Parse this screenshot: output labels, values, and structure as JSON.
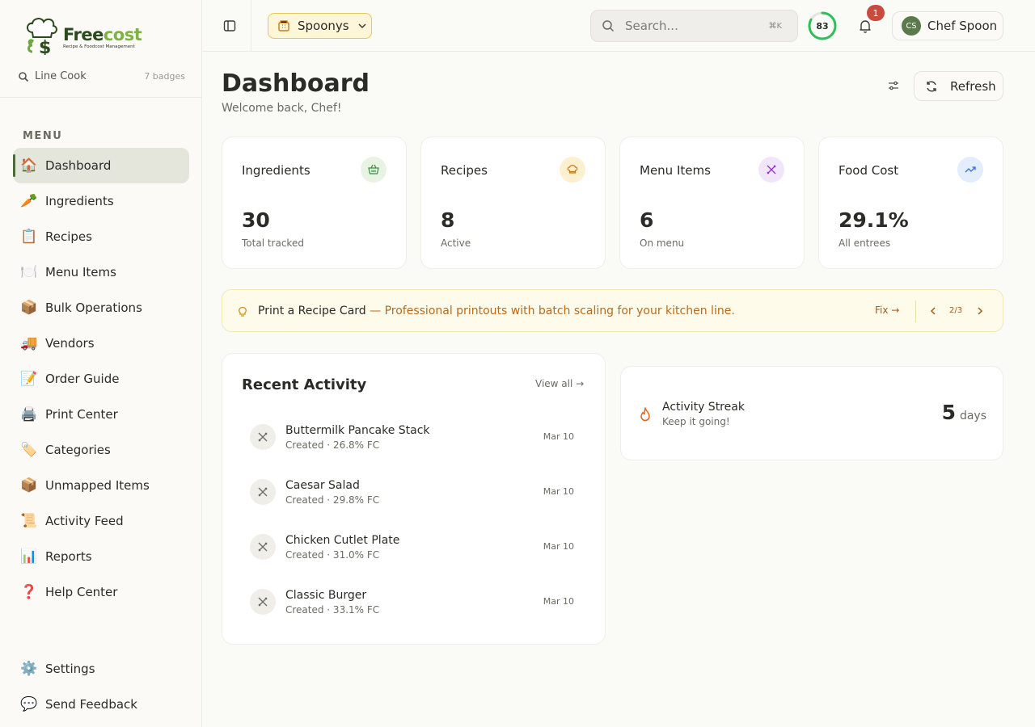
{
  "brand": {
    "name_part1": "Free",
    "name_part2": "cost",
    "tagline": "Recipe & Foodcost Management"
  },
  "sidebar": {
    "role": "Line Cook",
    "badges": "7 badges",
    "menu_label": "MENU",
    "items": [
      {
        "icon": "🏠",
        "label": "Dashboard",
        "active": true
      },
      {
        "icon": "🥕",
        "label": "Ingredients"
      },
      {
        "icon": "📋",
        "label": "Recipes"
      },
      {
        "icon": "🍽️",
        "label": "Menu Items"
      },
      {
        "icon": "📦",
        "label": "Bulk Operations"
      },
      {
        "icon": "🚚",
        "label": "Vendors"
      },
      {
        "icon": "📝",
        "label": "Order Guide"
      },
      {
        "icon": "🖨️",
        "label": "Print Center"
      },
      {
        "icon": "🏷️",
        "label": "Categories"
      },
      {
        "icon": "📦",
        "label": "Unmapped Items"
      },
      {
        "icon": "📜",
        "label": "Activity Feed"
      },
      {
        "icon": "📊",
        "label": "Reports"
      },
      {
        "icon": "❓",
        "label": "Help Center"
      }
    ],
    "bottom_items": [
      {
        "icon": "⚙️",
        "label": "Settings"
      },
      {
        "icon": "💬",
        "label": "Send Feedback"
      }
    ]
  },
  "topbar": {
    "store": "Spoonys",
    "search_placeholder": "Search...",
    "search_shortcut": "⌘K",
    "score": "83",
    "score_fraction": 0.83,
    "notifications": "1",
    "user_initials": "CS",
    "user_name": "Chef Spoon"
  },
  "page": {
    "title": "Dashboard",
    "subtitle": "Welcome back, Chef!",
    "refresh_label": "Refresh"
  },
  "stats": [
    {
      "title": "Ingredients",
      "value": "30",
      "sub": "Total tracked",
      "icon": "basket-icon",
      "icon_bg": "#e8f3e4",
      "icon_color": "#3d8b3d"
    },
    {
      "title": "Recipes",
      "value": "8",
      "sub": "Active",
      "icon": "chef-hat-icon",
      "icon_bg": "#fdf0cf",
      "icon_color": "#c97a12"
    },
    {
      "title": "Menu Items",
      "value": "6",
      "sub": "On menu",
      "icon": "utensils-icon",
      "icon_bg": "#f1e6f9",
      "icon_color": "#9333c9"
    },
    {
      "title": "Food Cost",
      "value": "29.1%",
      "sub": "All entrees",
      "icon": "trending-up-icon",
      "icon_bg": "#e3edfb",
      "icon_color": "#2f6fd6"
    }
  ],
  "tip": {
    "title": "Print a Recipe Card",
    "text": " — Professional printouts with batch scaling for your kitchen line.",
    "fix_label": "Fix →",
    "page": "2/3"
  },
  "activity": {
    "title": "Recent Activity",
    "view_all": "View all →",
    "items": [
      {
        "name": "Buttermilk Pancake Stack",
        "meta": "Created · 26.8% FC",
        "date": "Mar 10"
      },
      {
        "name": "Caesar Salad",
        "meta": "Created · 29.8% FC",
        "date": "Mar 10"
      },
      {
        "name": "Chicken Cutlet Plate",
        "meta": "Created · 31.0% FC",
        "date": "Mar 10"
      },
      {
        "name": "Classic Burger",
        "meta": "Created · 33.1% FC",
        "date": "Mar 10"
      }
    ]
  },
  "streak": {
    "title": "Activity Streak",
    "sub": "Keep it going!",
    "value": "5",
    "unit": "days"
  }
}
